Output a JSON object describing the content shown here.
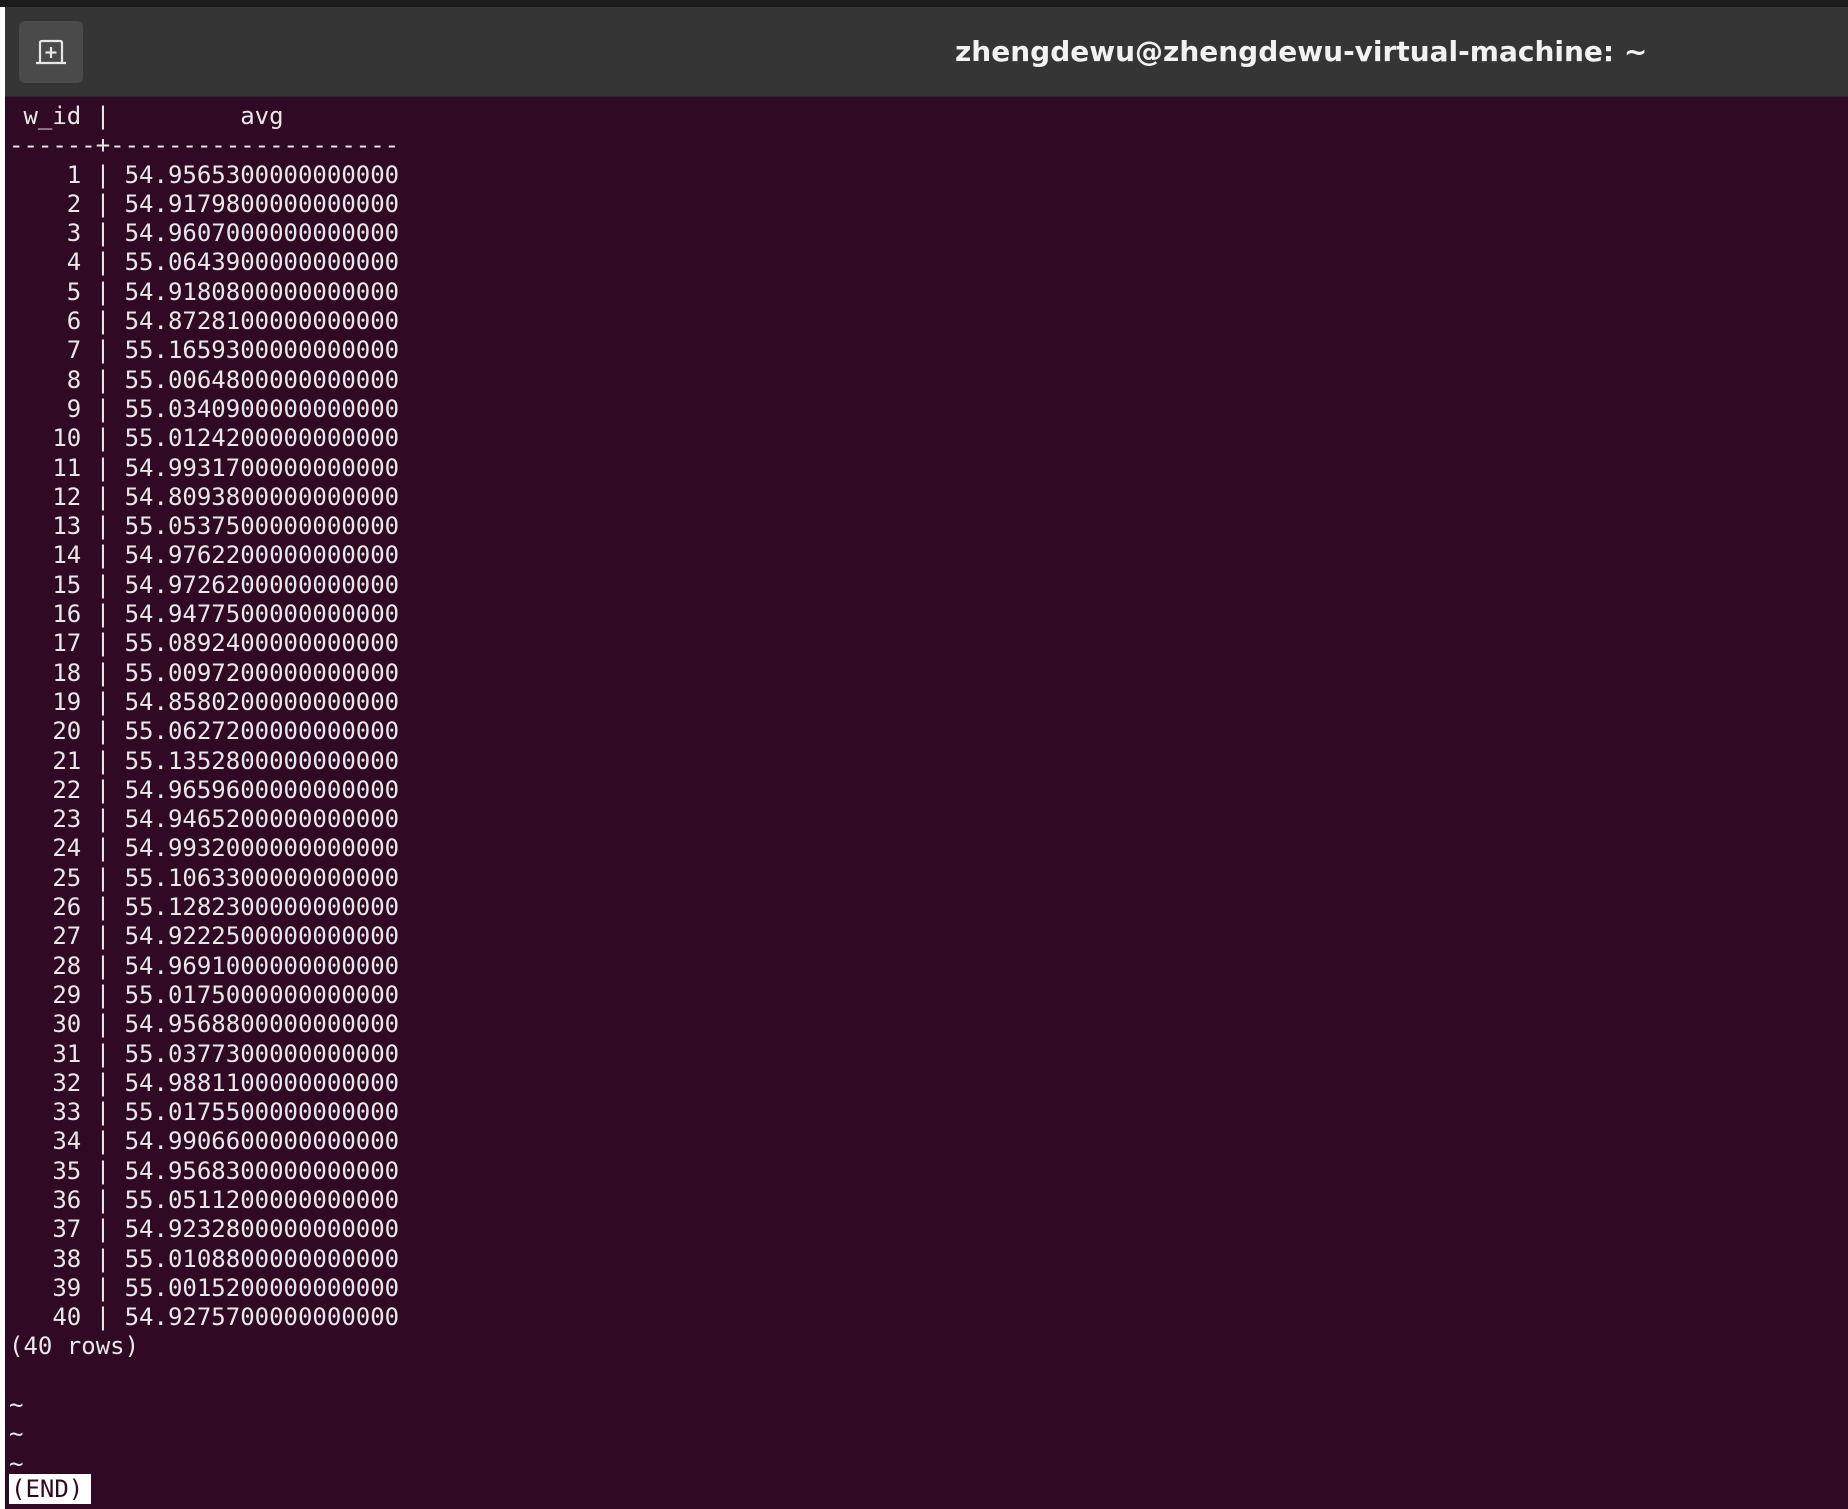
{
  "window": {
    "title": "zhengdewu@zhengdewu-virtual-machine: ~",
    "new_tab_icon": "new-tab-icon"
  },
  "colors": {
    "terminal_bg": "#300a24",
    "titlebar_bg": "#353535",
    "text": "#e8e8e8"
  },
  "query_result": {
    "header": " w_id |         avg",
    "separator": "------+--------------------",
    "rows": [
      "    1 | 54.9565300000000000",
      "    2 | 54.9179800000000000",
      "    3 | 54.9607000000000000",
      "    4 | 55.0643900000000000",
      "    5 | 54.9180800000000000",
      "    6 | 54.8728100000000000",
      "    7 | 55.1659300000000000",
      "    8 | 55.0064800000000000",
      "    9 | 55.0340900000000000",
      "   10 | 55.0124200000000000",
      "   11 | 54.9931700000000000",
      "   12 | 54.8093800000000000",
      "   13 | 55.0537500000000000",
      "   14 | 54.9762200000000000",
      "   15 | 54.9726200000000000",
      "   16 | 54.9477500000000000",
      "   17 | 55.0892400000000000",
      "   18 | 55.0097200000000000",
      "   19 | 54.8580200000000000",
      "   20 | 55.0627200000000000",
      "   21 | 55.1352800000000000",
      "   22 | 54.9659600000000000",
      "   23 | 54.9465200000000000",
      "   24 | 54.9932000000000000",
      "   25 | 55.1063300000000000",
      "   26 | 55.1282300000000000",
      "   27 | 54.9222500000000000",
      "   28 | 54.9691000000000000",
      "   29 | 55.0175000000000000",
      "   30 | 54.9568800000000000",
      "   31 | 55.0377300000000000",
      "   32 | 54.9881100000000000",
      "   33 | 55.0175500000000000",
      "   34 | 54.9906600000000000",
      "   35 | 54.9568300000000000",
      "   36 | 55.0511200000000000",
      "   37 | 54.9232800000000000",
      "   38 | 55.0108800000000000",
      "   39 | 55.0015200000000000",
      "   40 | 54.9275700000000000"
    ],
    "footer": "(40 rows)",
    "tildes": [
      "~",
      "~",
      "~"
    ],
    "end_marker": "(END)"
  }
}
